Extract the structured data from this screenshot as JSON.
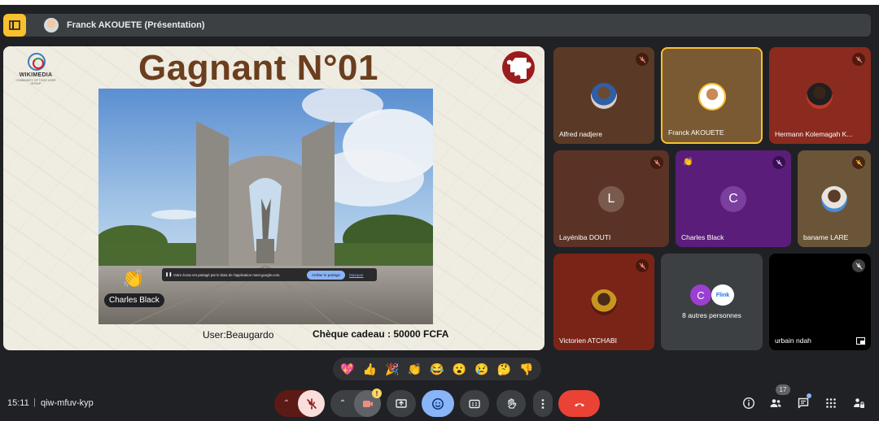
{
  "presenter": {
    "name_label": "Franck AKOUETE (Présentation)"
  },
  "slide": {
    "logo_title": "WIKIMEDIA",
    "logo_sub": "COMMUNITY OF TOGO USER GROUP",
    "title": "Gagnant N°01",
    "user": "User:Beaugardo",
    "prize": "Chèque cadeau : 50000 FCFA",
    "share_notice_text": "Votre écran est partagé par le biais de l'application meet.google.com.",
    "share_stop_label": "Arrêter le partage",
    "share_hide_label": "Masquer",
    "reaction_label": "Charles Black"
  },
  "participants": [
    {
      "name": "Alfred nadjere",
      "muted": true,
      "bg": "#5a3a26"
    },
    {
      "name": "Franck AKOUETE",
      "muted": false,
      "bg": "#7a5a33",
      "speaking": true
    },
    {
      "name": "Hermann Kolemagah K...",
      "muted": true,
      "bg": "#8b2a1e"
    },
    {
      "name": "Layéniba DOUTI",
      "muted": true,
      "bg": "#5a3326",
      "initial": "L"
    },
    {
      "name": "Charles Black",
      "muted": true,
      "bg": "#5b1d7a",
      "initial": "C"
    },
    {
      "name": "baname LARE",
      "muted": true,
      "bg": "#6a5538"
    },
    {
      "name": "Victorien ATCHABI",
      "muted": true,
      "bg": "#7a2418"
    },
    {
      "name": "urbain ndah",
      "muted": true,
      "bg": "#000000"
    }
  ],
  "others": {
    "label": "8 autres personnes",
    "initial": "C"
  },
  "reactions": [
    "💖",
    "👍",
    "🎉",
    "👏",
    "😂",
    "😮",
    "😢",
    "🤔",
    "👎"
  ],
  "bottom": {
    "time": "15:11",
    "separator": "|",
    "meeting_code": "qiw-mfuv-kyp",
    "people_count": "17",
    "camera_alert": "!"
  },
  "colors": {
    "end_call": "#ea4335",
    "active_ctrl": "#8ab4f8",
    "muted_ctrl": "#f9dedc",
    "accent": "#f9c12e"
  }
}
